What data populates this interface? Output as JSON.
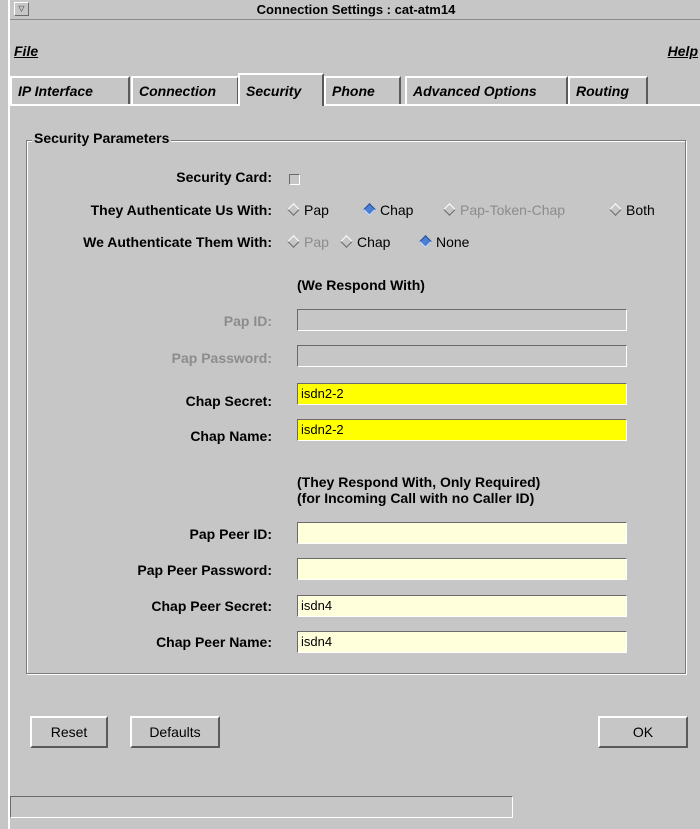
{
  "window": {
    "title": "Connection Settings : cat-atm14",
    "menu_icon": "window-menu-icon"
  },
  "menubar": {
    "file": "File",
    "help": "Help"
  },
  "tabs": [
    {
      "label": "IP Interface"
    },
    {
      "label": "Connection"
    },
    {
      "label": "Security",
      "active": true
    },
    {
      "label": "Phone"
    },
    {
      "label": "Advanced Options"
    },
    {
      "label": "Routing"
    }
  ],
  "security": {
    "group_title": "Security Parameters",
    "security_card_label": "Security Card:",
    "they_auth_label": "They Authenticate Us With:",
    "they_auth_options": [
      "Pap",
      "Chap",
      "Pap-Token-Chap",
      "Both"
    ],
    "they_auth_selected": "Chap",
    "we_auth_label": "We Authenticate Them With:",
    "we_auth_options": [
      "Pap",
      "Chap",
      "None"
    ],
    "we_auth_selected": "None",
    "we_respond_note": "(We Respond With)",
    "pap_id_label": "Pap ID:",
    "pap_id_value": "",
    "pap_password_label": "Pap Password:",
    "pap_password_value": "",
    "chap_secret_label": "Chap Secret:",
    "chap_secret_value": "isdn2-2",
    "chap_name_label": "Chap Name:",
    "chap_name_value": "isdn2-2",
    "they_respond_note_1": "(They Respond With, Only Required)",
    "they_respond_note_2": "(for Incoming Call with no Caller ID)",
    "pap_peer_id_label": "Pap Peer ID:",
    "pap_peer_id_value": "",
    "pap_peer_password_label": "Pap Peer Password:",
    "pap_peer_password_value": "",
    "chap_peer_secret_label": "Chap Peer Secret:",
    "chap_peer_secret_value": "isdn4",
    "chap_peer_name_label": "Chap Peer Name:",
    "chap_peer_name_value": "isdn4"
  },
  "buttons": {
    "reset": "Reset",
    "defaults": "Defaults",
    "ok": "OK"
  },
  "colors": {
    "bg": "#c6c6c6",
    "required_field": "#ffff00",
    "optional_field": "#ffffdc",
    "radio_on": "#4a7fd1"
  }
}
